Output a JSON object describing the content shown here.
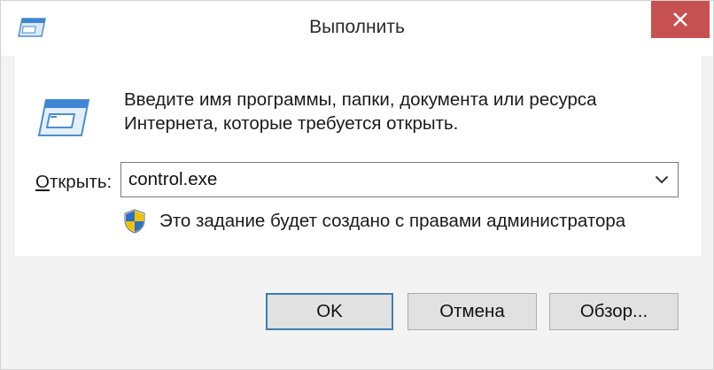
{
  "window": {
    "title": "Выполнить",
    "close_icon": "close-icon",
    "app_icon": "run-window-icon"
  },
  "content": {
    "description_line1": "Введите имя программы, папки, документа или ресурса",
    "description_line2": "Интернета, которые требуется открыть.",
    "open_label_accel": "О",
    "open_label_rest": "ткрыть:",
    "command_value": "control.exe",
    "admin_notice": "Это задание будет создано с правами администратора"
  },
  "buttons": {
    "ok": "OK",
    "cancel": "Отмена",
    "browse": "Обзор..."
  },
  "colors": {
    "close_button": "#c75050",
    "ok_border": "#3c7fb1",
    "window_bg": "#f3f3f3"
  }
}
